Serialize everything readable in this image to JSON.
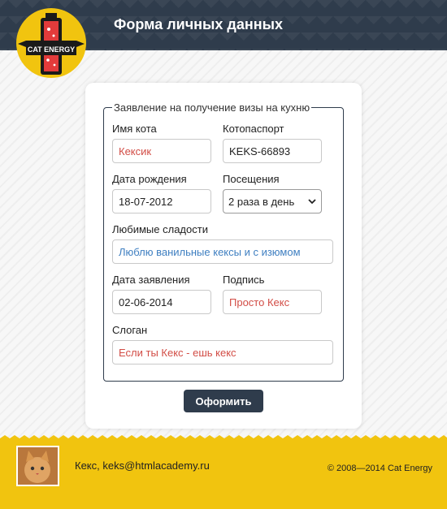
{
  "header": {
    "title": "Форма личных данных",
    "logo_text": "CAT ENERGY"
  },
  "form": {
    "legend": "Заявление на получение визы на кухню",
    "cat_name": {
      "label": "Имя кота",
      "value": "Кексик"
    },
    "passport": {
      "label": "Котопаспорт",
      "value": "KEKS-66893"
    },
    "birth_date": {
      "label": "Дата рождения",
      "value": "18-07-2012"
    },
    "visits": {
      "label": "Посещения",
      "selected": "2 раза в день"
    },
    "sweets": {
      "label": "Любимые сладости",
      "value": "Люблю ванильные кексы и с изюмом"
    },
    "application_date": {
      "label": "Дата заявления",
      "value": "02-06-2014"
    },
    "signature": {
      "label": "Подпись",
      "value": "Просто Кекс"
    },
    "slogan": {
      "label": "Слоган",
      "value": "Если ты Кекс - ешь кекс"
    },
    "submit_label": "Оформить"
  },
  "footer": {
    "contact": "Кекс, keks@htmlacademy.ru",
    "copyright": "© 2008—2014 Cat Energy"
  },
  "colors": {
    "header_bg": "#2f3c4c",
    "accent_yellow": "#f1c40f",
    "value_red": "#d24d46",
    "value_blue": "#3f7fc1"
  }
}
